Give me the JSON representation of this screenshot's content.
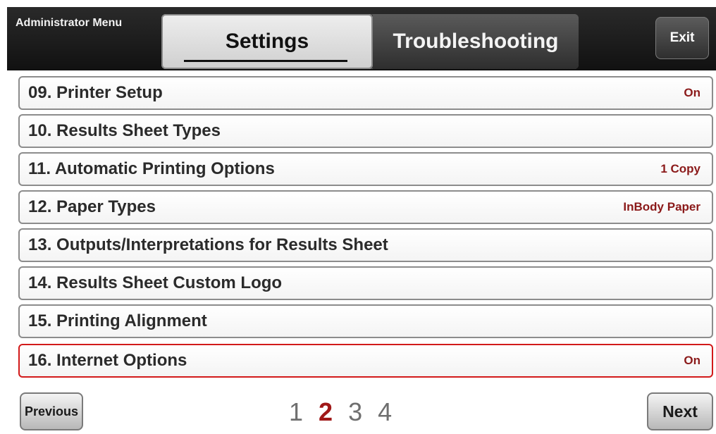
{
  "header": {
    "title": "Administrator Menu",
    "tabs": [
      {
        "label": "Settings",
        "active": true
      },
      {
        "label": "Troubleshooting",
        "active": false
      }
    ],
    "exit_label": "Exit"
  },
  "menu": {
    "items": [
      {
        "label": "09. Printer Setup",
        "value": "On"
      },
      {
        "label": "10. Results Sheet Types",
        "value": ""
      },
      {
        "label": "11. Automatic Printing Options",
        "value": "1 Copy"
      },
      {
        "label": "12. Paper Types",
        "value": "InBody Paper"
      },
      {
        "label": "13. Outputs/Interpretations for Results Sheet",
        "value": ""
      },
      {
        "label": "14. Results Sheet Custom Logo",
        "value": ""
      },
      {
        "label": "15. Printing Alignment",
        "value": ""
      },
      {
        "label": "16. Internet Options",
        "value": "On",
        "selected": true
      }
    ]
  },
  "pagination": {
    "previous_label": "Previous",
    "next_label": "Next",
    "pages": [
      "1",
      "2",
      "3",
      "4"
    ],
    "current": "2"
  },
  "colors": {
    "value_text": "#8b1a1a",
    "selected_border": "#d21a1a",
    "current_page": "#a01818"
  }
}
